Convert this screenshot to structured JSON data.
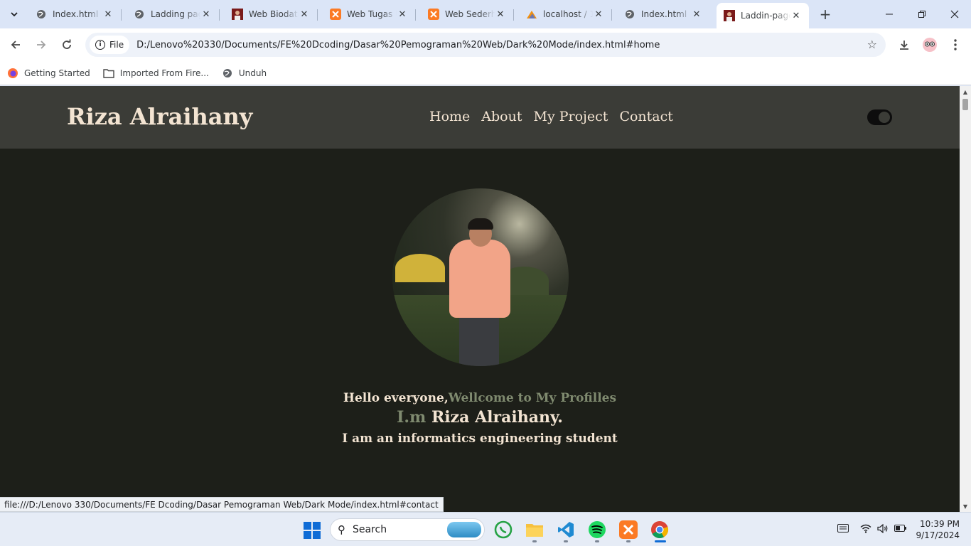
{
  "browser": {
    "tabs": [
      {
        "title": "Index.html",
        "favicon": "globe-icon"
      },
      {
        "title": "Ladding page",
        "favicon": "globe-icon"
      },
      {
        "title": "Web Biodata",
        "favicon": "photo-favicon"
      },
      {
        "title": "Web Tugas UAS",
        "favicon": "xampp-icon"
      },
      {
        "title": "Web Sederhana",
        "favicon": "xampp-icon"
      },
      {
        "title": "localhost / 1",
        "favicon": "phpmyadmin-icon"
      },
      {
        "title": "Index.html",
        "favicon": "globe-icon"
      },
      {
        "title": "Laddin-page",
        "favicon": "photo-favicon"
      }
    ],
    "chip_label": "File",
    "url": "D:/Lenovo%20330/Documents/FE%20Dcoding/Dasar%20Pemograman%20Web/Dark%20Mode/index.html#home",
    "bookmarks": [
      "Getting Started",
      "Imported From Fire...",
      "Unduh"
    ],
    "status_url": "file:///D:/Lenovo 330/Documents/FE Dcoding/Dasar Pemograman Web/Dark Mode/index.html#contact"
  },
  "site": {
    "brand": "Riza Alraihany",
    "nav": [
      "Home",
      "About",
      "My Project",
      "Contact"
    ],
    "greeting": "Hello everyone,",
    "welcome": "Wellcome to My Profilles",
    "im_prefix": "I.m",
    "name": "Riza Alraihany",
    "name_suffix": ".",
    "tagline": "I am an informatics engineering student",
    "colors": {
      "header_bg": "#3b3c37",
      "body_bg": "#1d1f19",
      "text": "#f3e4d2",
      "muted": "#7f8a6f"
    }
  },
  "taskbar": {
    "search_placeholder": "Search",
    "time": "10:39 PM",
    "date": "9/17/2024"
  }
}
